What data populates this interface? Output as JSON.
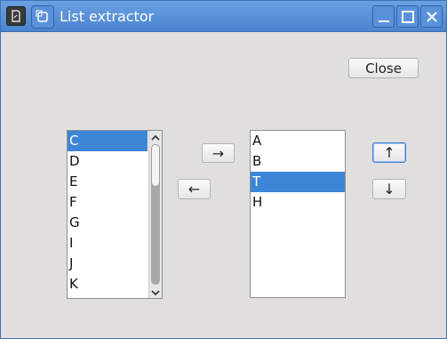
{
  "window": {
    "title": "List extractor"
  },
  "buttons": {
    "close_label": "Close",
    "move_right_label": "→",
    "move_left_label": "←",
    "move_up_label": "↑",
    "move_down_label": "↓"
  },
  "left_list": {
    "items": [
      "C",
      "D",
      "E",
      "F",
      "G",
      "I",
      "J",
      "K"
    ],
    "selected_index": 0
  },
  "right_list": {
    "items": [
      "A",
      "B",
      "T",
      "H"
    ],
    "selected_index": 2
  },
  "colors": {
    "selection": "#3d85d6",
    "titlebar": "#5a92da"
  }
}
